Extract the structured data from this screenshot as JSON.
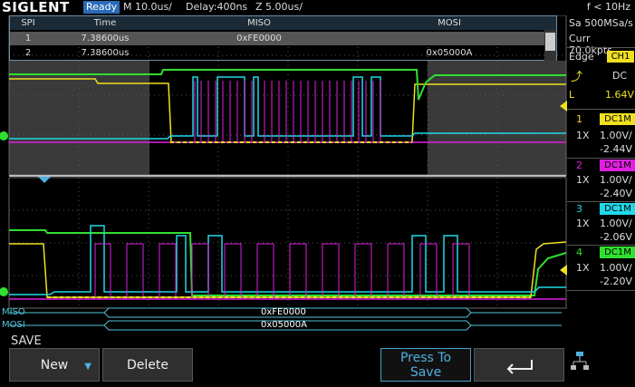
{
  "header": {
    "brand": "SIGLENT",
    "status": "Ready",
    "timebase": "M 10.0us/",
    "delay": "Delay:400ns",
    "zoom": "Z 5.00us/",
    "trigger_freq": "f < 10Hz"
  },
  "acquisition": {
    "sample_rate": "Sa 500MSa/s",
    "memory": "Curr 70.0kpts"
  },
  "trigger": {
    "type": "Edge",
    "source": "CH1",
    "slope_icon": "rising-edge-icon",
    "coupling": "DC",
    "level_label": "L",
    "level": "1.64V"
  },
  "channels": [
    {
      "num": "1",
      "coupling": "DC1M",
      "probe": "1X",
      "scale": "1.00V/",
      "offset": "-2.44V",
      "color": "#f0e020"
    },
    {
      "num": "2",
      "coupling": "DC1M",
      "probe": "1X",
      "scale": "1.00V/",
      "offset": "-2.40V",
      "color": "#e020e0"
    },
    {
      "num": "3",
      "coupling": "DC1M",
      "probe": "1X",
      "scale": "1.00V/",
      "offset": "-2.06V",
      "color": "#20d8e8"
    },
    {
      "num": "4",
      "coupling": "DC1M",
      "probe": "1X",
      "scale": "1.00V/",
      "offset": "-2.20V",
      "color": "#30e030"
    }
  ],
  "decode_table": {
    "headers": [
      "SPI",
      "Time",
      "MISO",
      "MOSI"
    ],
    "rows": [
      {
        "index": "1",
        "time": "7.38600us",
        "miso": "0xFE0000",
        "mosi": ""
      },
      {
        "index": "2",
        "time": "7.38600us",
        "miso": "",
        "mosi": "0x05000A"
      }
    ]
  },
  "bus": {
    "miso_label": "MISO",
    "miso_value": "0xFE0000",
    "mosi_label": "MOSI",
    "mosi_value": "0x05000A"
  },
  "menu": {
    "title": "SAVE",
    "new_label": "New",
    "delete_label": "Delete",
    "press_label_1": "Press To",
    "press_label_2": "Save",
    "back_icon": "return-arrow-icon",
    "network_icon": "network-icon"
  }
}
